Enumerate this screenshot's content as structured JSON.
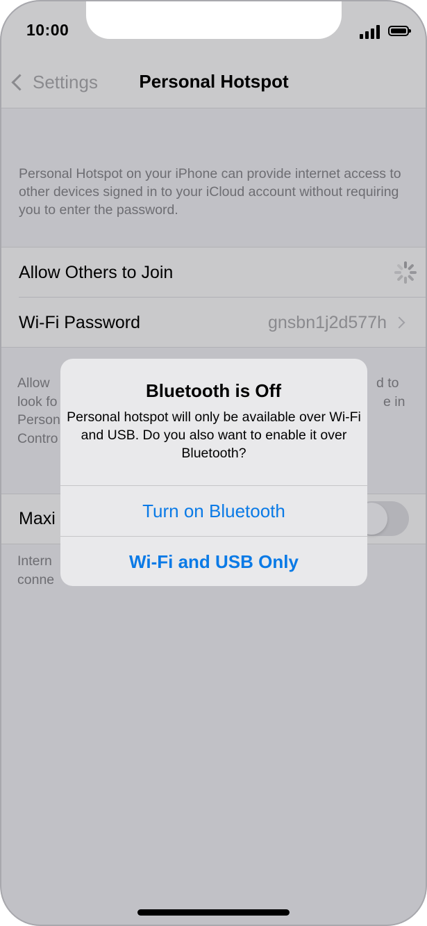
{
  "status_bar": {
    "time": "10:00",
    "signal_icon": "cellular-signal-icon",
    "battery_icon": "battery-icon"
  },
  "nav": {
    "back_label": "Settings",
    "back_icon": "chevron-left-icon",
    "title": "Personal Hotspot"
  },
  "description": "Personal Hotspot on your iPhone can provide internet access to other devices signed in to your iCloud account without requiring you to enter the password.",
  "settings": {
    "allow_others_label": "Allow Others to Join",
    "allow_others_icon": "activity-spinner-icon",
    "wifi_password_label": "Wi-Fi Password",
    "wifi_password_value": "gnsbn1j2d577h"
  },
  "footnote_left": [
    "Allow",
    "look fo",
    "Person",
    "Contro"
  ],
  "footnote_right": [
    "d to",
    "e in"
  ],
  "maximize_label": "Maxi",
  "footnote2_left": [
    "Intern",
    "conne"
  ],
  "alert": {
    "title": "Bluetooth is Off",
    "message": "Personal hotspot will only be available over Wi-Fi and USB. Do you also want to enable it over Bluetooth?",
    "primary_button": "Turn on Bluetooth",
    "secondary_button": "Wi-Fi and USB Only"
  },
  "colors": {
    "accent": "#0a7ae6",
    "background_dimmed": "#c1c1c6",
    "alert_background": "#e9e9eb"
  }
}
